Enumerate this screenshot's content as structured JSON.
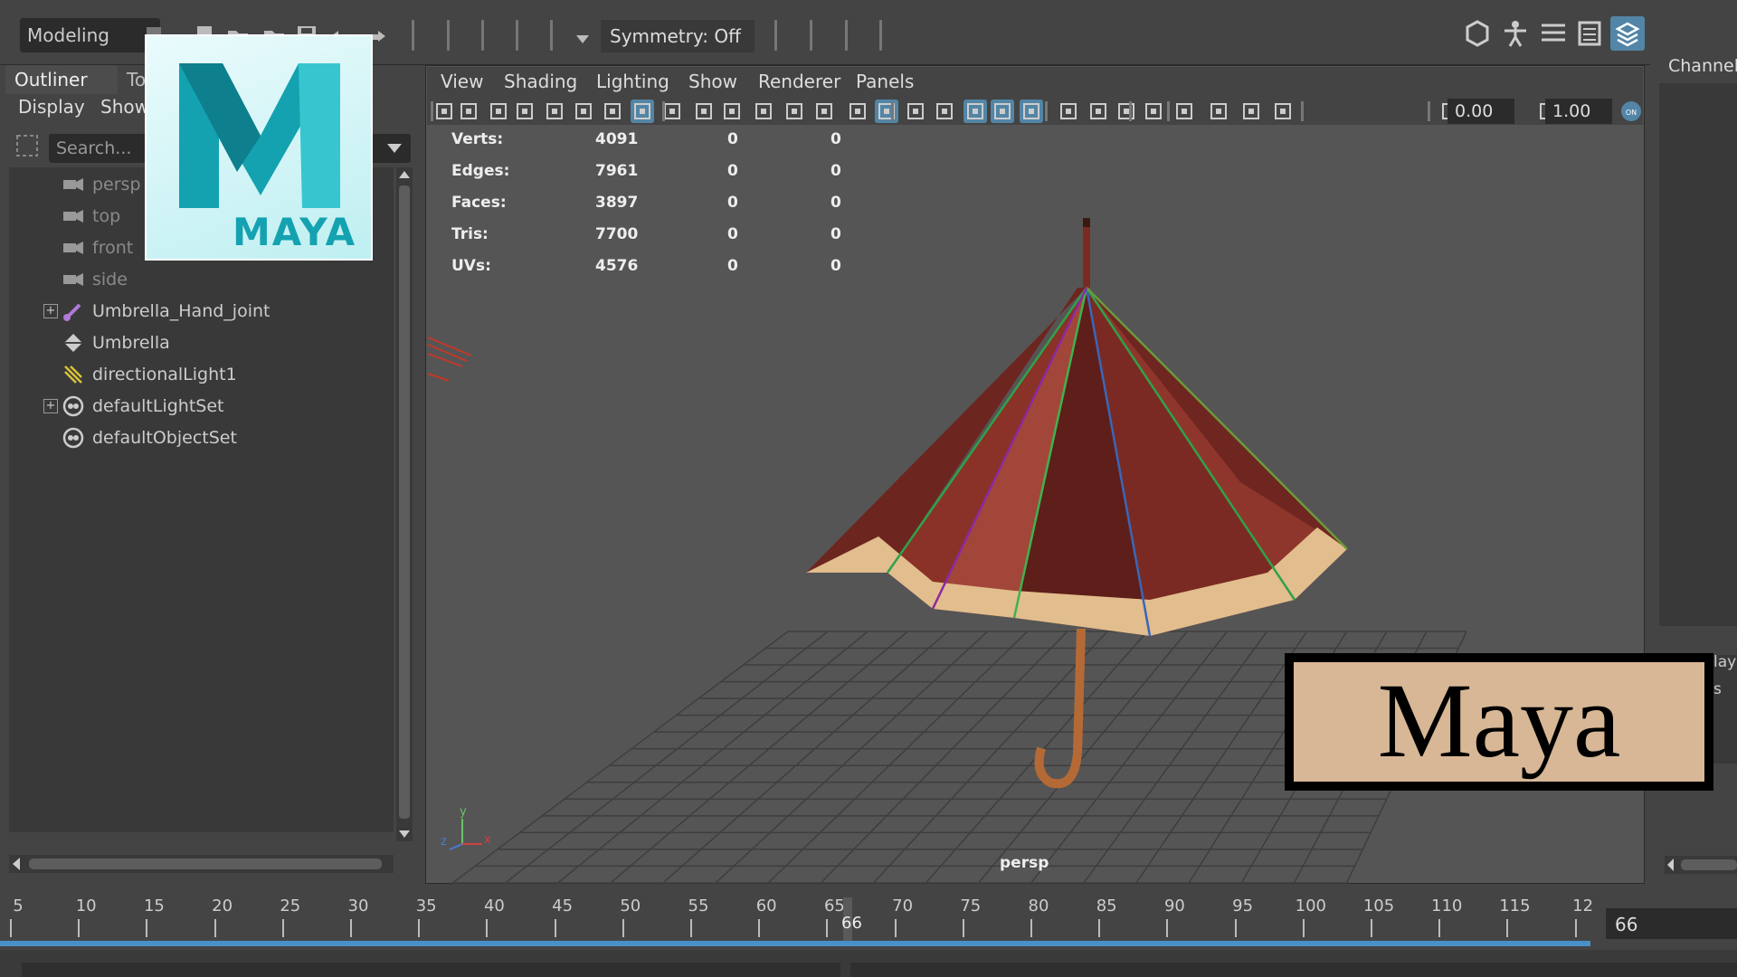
{
  "topbar": {
    "mode": "Modeling",
    "symmetry": "Symmetry: Off"
  },
  "outliner": {
    "tabs": [
      "Outliner",
      "To"
    ],
    "menu": [
      "Display",
      "Show"
    ],
    "search_placeholder": "Search...",
    "items": [
      {
        "label": "persp",
        "icon": "camera-icon",
        "dim": true,
        "expand": false
      },
      {
        "label": "top",
        "icon": "camera-icon",
        "dim": true,
        "expand": false
      },
      {
        "label": "front",
        "icon": "camera-icon",
        "dim": true,
        "expand": false
      },
      {
        "label": "side",
        "icon": "camera-icon",
        "dim": true,
        "expand": false
      },
      {
        "label": "Umbrella_Hand_joint",
        "icon": "joint-icon",
        "dim": false,
        "expand": true
      },
      {
        "label": "Umbrella",
        "icon": "mesh-icon",
        "dim": false,
        "expand": false
      },
      {
        "label": "directionalLight1",
        "icon": "directional-light-icon",
        "dim": false,
        "expand": false
      },
      {
        "label": "defaultLightSet",
        "icon": "set-icon",
        "dim": false,
        "expand": true
      },
      {
        "label": "defaultObjectSet",
        "icon": "set-icon",
        "dim": false,
        "expand": false
      }
    ]
  },
  "viewport": {
    "menu": [
      "View",
      "Shading",
      "Lighting",
      "Show",
      "Renderer",
      "Panels"
    ],
    "field_a": "0.00",
    "field_b": "1.00",
    "camera": "persp",
    "stats": [
      {
        "label": "Verts:",
        "v1": "4091",
        "v2": "0",
        "v3": "0"
      },
      {
        "label": "Edges:",
        "v1": "7961",
        "v2": "0",
        "v3": "0"
      },
      {
        "label": "Faces:",
        "v1": "3897",
        "v2": "0",
        "v3": "0"
      },
      {
        "label": "Tris:",
        "v1": "7700",
        "v2": "0",
        "v3": "0"
      },
      {
        "label": "UVs:",
        "v1": "4576",
        "v2": "0",
        "v3": "0"
      }
    ],
    "axis": {
      "x": "x",
      "y": "y",
      "z": "z"
    }
  },
  "channel": {
    "label": "Channel",
    "partial_a": "lay",
    "partial_b": "s"
  },
  "timeline": {
    "ticks": [
      "5",
      "10",
      "15",
      "20",
      "25",
      "30",
      "35",
      "40",
      "45",
      "50",
      "55",
      "60",
      "65",
      "70",
      "75",
      "80",
      "85",
      "90",
      "95",
      "100",
      "105",
      "110",
      "115",
      "12"
    ],
    "current_frame": "66",
    "current_frame_field": "66"
  },
  "overlays": {
    "logo_text": "MAYA",
    "banner_text": "Maya",
    "logo_colors": [
      "#14a2b1",
      "#0e7f8c",
      "#37c6cf"
    ]
  }
}
